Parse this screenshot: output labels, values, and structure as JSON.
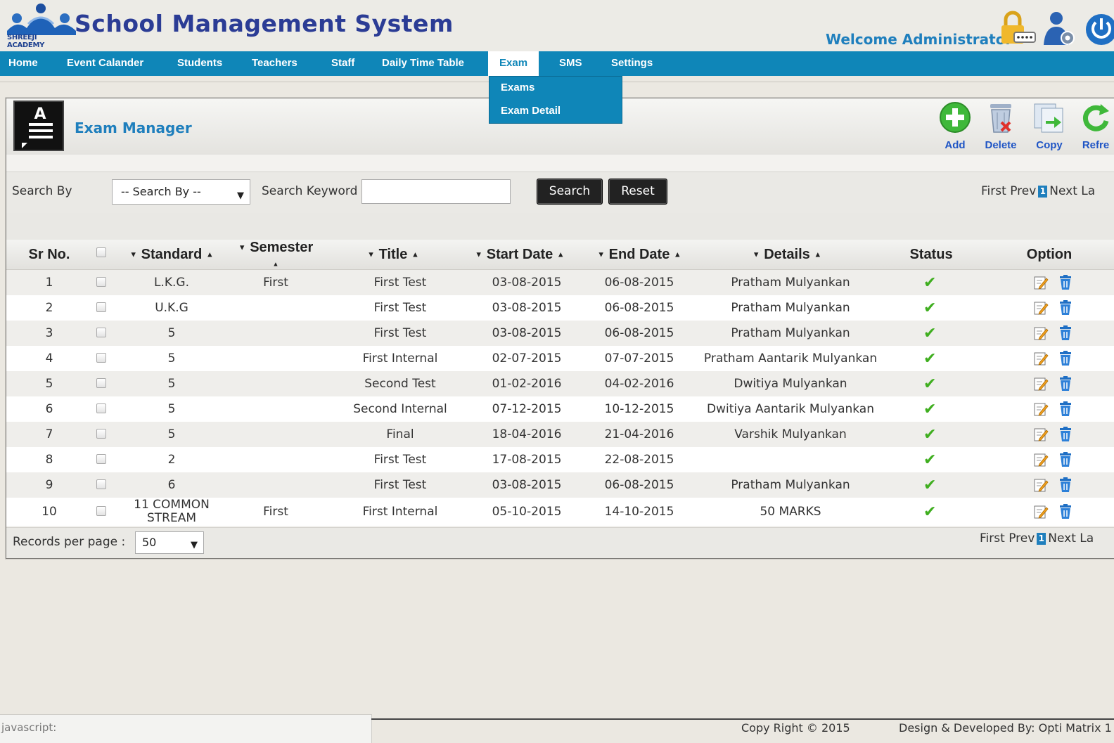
{
  "header": {
    "brand_sub": "SHREEJI ACADEMY",
    "app_title": "School Management System",
    "welcome": "Welcome Administrator"
  },
  "nav": {
    "items": [
      "Home",
      "Event Calander",
      "Students",
      "Teachers",
      "Staff",
      "Daily Time Table",
      "Exam",
      "SMS",
      "Settings"
    ],
    "active": "Exam",
    "dropdown": [
      "Exams",
      "Exam Detail"
    ]
  },
  "panel": {
    "title": "Exam Manager",
    "doc_icon_letter": "A",
    "tools": [
      "Add",
      "Delete",
      "Copy",
      "Refre"
    ]
  },
  "search": {
    "by_label": "Search By",
    "by_value": "-- Search By --",
    "keyword_label": "Search Keyword",
    "keyword_value": "",
    "search_btn": "Search",
    "reset_btn": "Reset"
  },
  "pager": {
    "first": "First",
    "prev": "Prev",
    "page": "1",
    "next": "Next",
    "last_top": "La",
    "last_bottom": "La"
  },
  "table": {
    "headers": [
      "Sr No.",
      "Standard",
      "Semester",
      "Title",
      "Start Date",
      "End Date",
      "Details",
      "Status",
      "Option"
    ],
    "rows": [
      [
        "1",
        "L.K.G.",
        "First",
        "First Test",
        "03-08-2015",
        "06-08-2015",
        "Pratham Mulyankan"
      ],
      [
        "2",
        "U.K.G",
        "",
        "First Test",
        "03-08-2015",
        "06-08-2015",
        "Pratham Mulyankan"
      ],
      [
        "3",
        "5",
        "",
        "First Test",
        "03-08-2015",
        "06-08-2015",
        "Pratham Mulyankan"
      ],
      [
        "4",
        "5",
        "",
        "First Internal",
        "02-07-2015",
        "07-07-2015",
        "Pratham Aantarik Mulyankan"
      ],
      [
        "5",
        "5",
        "",
        "Second Test",
        "01-02-2016",
        "04-02-2016",
        "Dwitiya Mulyankan"
      ],
      [
        "6",
        "5",
        "",
        "Second Internal",
        "07-12-2015",
        "10-12-2015",
        "Dwitiya Aantarik Mulyankan"
      ],
      [
        "7",
        "5",
        "",
        "Final",
        "18-04-2016",
        "21-04-2016",
        "Varshik Mulyankan"
      ],
      [
        "8",
        "2",
        "",
        "First Test",
        "17-08-2015",
        "22-08-2015",
        ""
      ],
      [
        "9",
        "6",
        "",
        "First Test",
        "03-08-2015",
        "06-08-2015",
        "Pratham Mulyankan"
      ],
      [
        "10",
        "11 COMMON STREAM",
        "First",
        "First Internal",
        "05-10-2015",
        "14-10-2015",
        "50 MARKS"
      ]
    ],
    "records_label": "Records per page :",
    "records_value": "50"
  },
  "footer": {
    "status_text": "javascript:",
    "copyright": "Copy Right © 2015",
    "developer": "Design & Developed By: Opti Matrix 1"
  },
  "colors": {
    "nav_bg": "#0f86b8",
    "title_blue": "#2b3c95",
    "accent_blue": "#1f7fbd",
    "status_green": "#3fae1f"
  }
}
